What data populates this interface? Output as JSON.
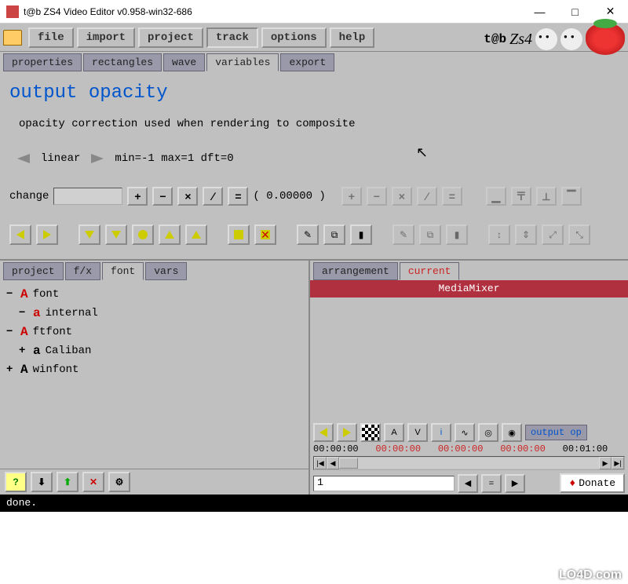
{
  "window": {
    "title": "t@b ZS4 Video Editor v0.958-win32-686",
    "minimize": "—",
    "maximize": "□",
    "close": "✕"
  },
  "menu": {
    "file": "file",
    "import": "import",
    "project": "project",
    "track": "track",
    "options": "options",
    "help": "help"
  },
  "brand": {
    "tab": "t@b",
    "zs4": "Zs4"
  },
  "tabs1": {
    "properties": "properties",
    "rectangles": "rectangles",
    "wave": "wave",
    "variables": "variables",
    "export": "export"
  },
  "panel": {
    "heading": "output opacity",
    "desc": "opacity correction used when rendering to composite",
    "mode": "linear",
    "range": "min=-1 max=1 dft=0",
    "change_label": "change",
    "value_display": "( 0.00000 )"
  },
  "ops": {
    "plus": "+",
    "minus": "−",
    "times": "×",
    "div": "∕",
    "eq": "="
  },
  "tabs2": {
    "project": "project",
    "fx": "f/x",
    "font": "font",
    "vars": "vars"
  },
  "tree": {
    "font": "font",
    "internal": "internal",
    "ftfont": "ftfont",
    "caliban": "Caliban",
    "winfont": "winfont"
  },
  "tabs3": {
    "arrangement": "arrangement",
    "current": "current"
  },
  "media": {
    "title": "MediaMixer"
  },
  "playbar": {
    "A": "A",
    "V": "V",
    "i": "i",
    "output_op": "output op"
  },
  "timecodes": {
    "t1": "00:00:00",
    "t2": "00:00:00",
    "t3": "00:00:00",
    "t4": "00:00:00",
    "t5": "00:01:00"
  },
  "frame": {
    "value": "1"
  },
  "bottom": {
    "help": "?",
    "donate": "Donate"
  },
  "status": {
    "text": "done."
  },
  "watermark": "LO4D.com"
}
